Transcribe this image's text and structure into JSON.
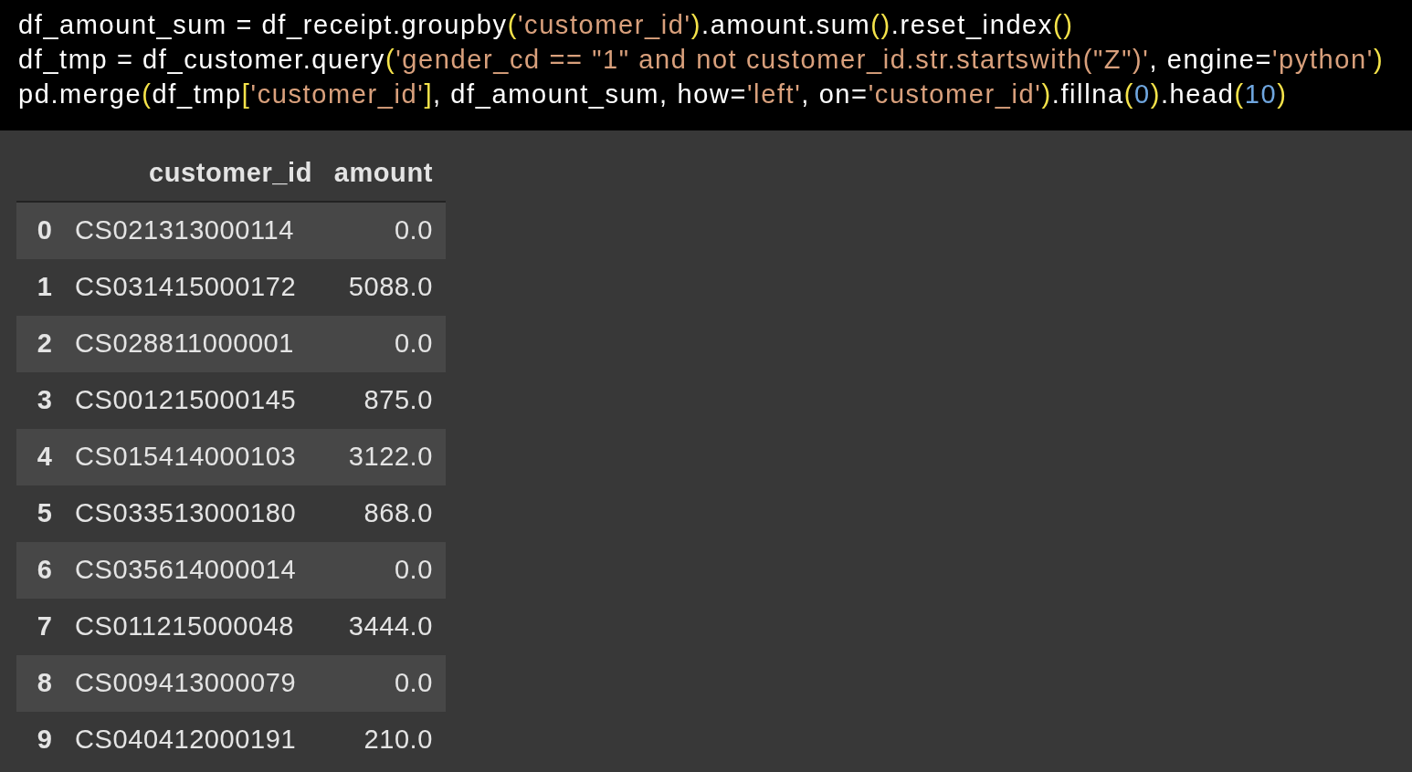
{
  "code_cell": {
    "lines": [
      [
        {
          "kind": "plain",
          "text": "df_amount_sum = df_receipt.groupby"
        },
        {
          "kind": "paren",
          "text": "("
        },
        {
          "kind": "string",
          "text": "'customer_id'"
        },
        {
          "kind": "paren",
          "text": ")"
        },
        {
          "kind": "plain",
          "text": ".amount.sum"
        },
        {
          "kind": "paren",
          "text": "()"
        },
        {
          "kind": "plain",
          "text": ".reset_index"
        },
        {
          "kind": "paren",
          "text": "()"
        }
      ],
      [
        {
          "kind": "plain",
          "text": "df_tmp = df_customer.query"
        },
        {
          "kind": "paren",
          "text": "("
        },
        {
          "kind": "string",
          "text": "'gender_cd == \"1\" and not customer_id.str.startswith(\"Z\")'"
        },
        {
          "kind": "plain",
          "text": ", engine="
        },
        {
          "kind": "string",
          "text": "'python'"
        },
        {
          "kind": "paren",
          "text": ")"
        }
      ],
      [
        {
          "kind": "plain",
          "text": "pd.merge"
        },
        {
          "kind": "paren",
          "text": "("
        },
        {
          "kind": "plain",
          "text": "df_tmp"
        },
        {
          "kind": "paren",
          "text": "["
        },
        {
          "kind": "string",
          "text": "'customer_id'"
        },
        {
          "kind": "paren",
          "text": "]"
        },
        {
          "kind": "plain",
          "text": ", df_amount_sum, how="
        },
        {
          "kind": "string",
          "text": "'left'"
        },
        {
          "kind": "plain",
          "text": ", on="
        },
        {
          "kind": "string",
          "text": "'customer_id'"
        },
        {
          "kind": "paren",
          "text": ")"
        },
        {
          "kind": "plain",
          "text": ".fillna"
        },
        {
          "kind": "paren",
          "text": "("
        },
        {
          "kind": "number",
          "text": "0"
        },
        {
          "kind": "paren",
          "text": ")"
        },
        {
          "kind": "plain",
          "text": ".head"
        },
        {
          "kind": "paren",
          "text": "("
        },
        {
          "kind": "number",
          "text": "10"
        },
        {
          "kind": "paren",
          "text": ")"
        }
      ]
    ]
  },
  "table": {
    "columns": [
      "customer_id",
      "amount"
    ],
    "rows": [
      {
        "index": "0",
        "customer_id": "CS021313000114",
        "amount": "0.0"
      },
      {
        "index": "1",
        "customer_id": "CS031415000172",
        "amount": "5088.0"
      },
      {
        "index": "2",
        "customer_id": "CS028811000001",
        "amount": "0.0"
      },
      {
        "index": "3",
        "customer_id": "CS001215000145",
        "amount": "875.0"
      },
      {
        "index": "4",
        "customer_id": "CS015414000103",
        "amount": "3122.0"
      },
      {
        "index": "5",
        "customer_id": "CS033513000180",
        "amount": "868.0"
      },
      {
        "index": "6",
        "customer_id": "CS035614000014",
        "amount": "0.0"
      },
      {
        "index": "7",
        "customer_id": "CS011215000048",
        "amount": "3444.0"
      },
      {
        "index": "8",
        "customer_id": "CS009413000079",
        "amount": "0.0"
      },
      {
        "index": "9",
        "customer_id": "CS040412000191",
        "amount": "210.0"
      }
    ]
  }
}
